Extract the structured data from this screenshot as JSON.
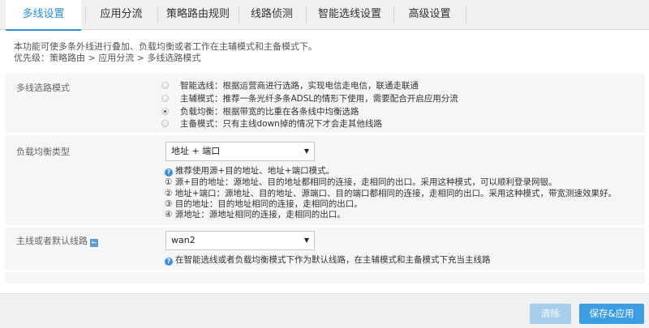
{
  "tabs": [
    {
      "label": "多线设置",
      "active": true
    },
    {
      "label": "应用分流",
      "active": false
    },
    {
      "label": "策略路由规则",
      "active": false
    },
    {
      "label": "线路侦测",
      "active": false
    },
    {
      "label": "智能选线设置",
      "active": false
    },
    {
      "label": "高级设置",
      "active": false
    }
  ],
  "intro": {
    "line1": "本功能可使多条外线进行叠加、负载均衡或者工作在主辅模式和主备模式下。",
    "line2": "优先级：策略路由 > 应用分流 > 多线选路模式"
  },
  "mode_section": {
    "label": "多线选路模式",
    "options": [
      {
        "text": "智能选线：根据运营商进行选路，实现电信走电信，联通走联通",
        "checked": false
      },
      {
        "text": "主辅模式：推荐一条光纤多条ADSL的情形下使用，需要配合开启应用分流",
        "checked": false
      },
      {
        "text": "负载均衡：根据带宽的比重在各条线中均衡选路",
        "checked": true
      },
      {
        "text": "主备模式：只有主线down掉的情况下才会走其他线路",
        "checked": false
      }
    ]
  },
  "balance_section": {
    "label": "负载均衡类型",
    "selected": "地址 + 端口",
    "hints": [
      "推荐使用源+目的地址、地址+端口模式。",
      "① 源+目的地址：源地址、目的地址都相同的连接，走相同的出口。采用这种模式，可以顺利登录网银。",
      "② 地址+端口：源地址、目的地址、源端口、目的端口都相同的连接，走相同的出口。采用这种模式，带宽测速效果好。",
      "③ 目的地址：目的地址相同的连接，走相同的出口。",
      "④ 源地址：源地址相同的连接，走相同的出口。"
    ]
  },
  "default_line_section": {
    "label": "主线或者默认线路",
    "selected": "wan2",
    "hint": "在智能选线或者负载均衡模式下作为默认线路，在主辅模式和主备模式下充当主线路"
  },
  "icons": {
    "info": "info-icon",
    "back": "back-arrow-icon",
    "caret": "caret-down-icon",
    "info_glyph": "?",
    "back_glyph": "←",
    "caret_glyph": "▼"
  },
  "buttons": {
    "clear": "清除",
    "save": "保存&应用"
  },
  "colors": {
    "accent": "#2a8fd6",
    "save_button": "#3c9de2",
    "clear_button": "#a6cdec"
  }
}
